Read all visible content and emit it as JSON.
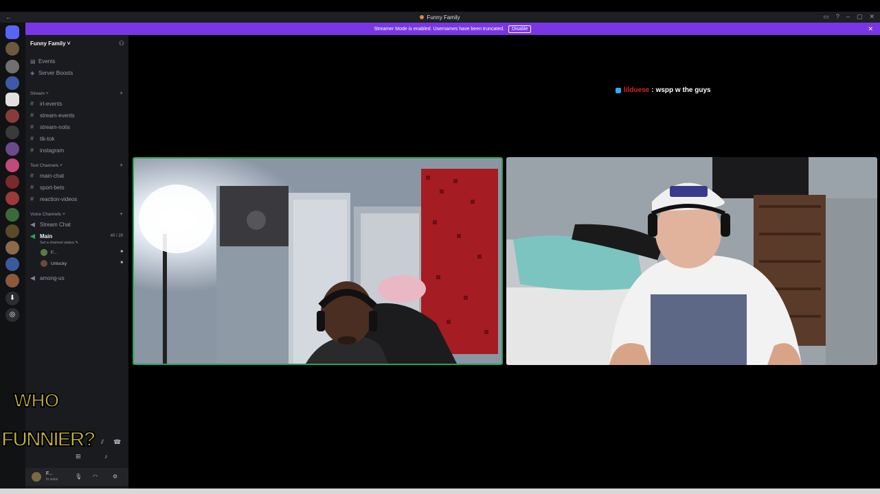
{
  "window": {
    "title": "Funny Family",
    "back": "←",
    "buttons": [
      "▭",
      "?",
      "–",
      "▢",
      "✕"
    ]
  },
  "banner": {
    "text": "Streamer Mode is enabled. Usernames have been truncated.",
    "disable_label": "Disable",
    "close": "✕"
  },
  "server": {
    "name": "Funny Family ˅",
    "nav": [
      {
        "icon": "calendar-icon",
        "glyph": "▤",
        "label": "Events"
      },
      {
        "icon": "boost-icon",
        "glyph": "◈",
        "label": "Server Boosts"
      }
    ],
    "categories": {
      "stream": "Stream ˅",
      "text": "Text Channels ˅",
      "voice": "Voice Channels ˅"
    },
    "stream_channels": [
      "irl-events",
      "stream-events",
      "stream-notis",
      "tik-tok",
      "instagram"
    ],
    "text_channels": [
      "main-chat",
      "sport-bets",
      "reaction-videos"
    ],
    "voice": {
      "stream_chat": "Stream Chat",
      "main": "Main",
      "main_count": "40 / 29",
      "status": "Set a channel status ✎",
      "users": [
        "F...",
        "Unlucky"
      ],
      "among_us": "among-us"
    }
  },
  "user_bar": {
    "name": "F...",
    "status": "In voice"
  },
  "overlay": {
    "line1": "WHO",
    "line2": "FUNNIER?"
  },
  "chat": {
    "user": "lilduese",
    "separator": ":",
    "message": "wspp w the guys"
  },
  "colors": {
    "banner": "#7a36e6",
    "speaking_border": "#23a55a",
    "chat_user": "#e02020"
  }
}
